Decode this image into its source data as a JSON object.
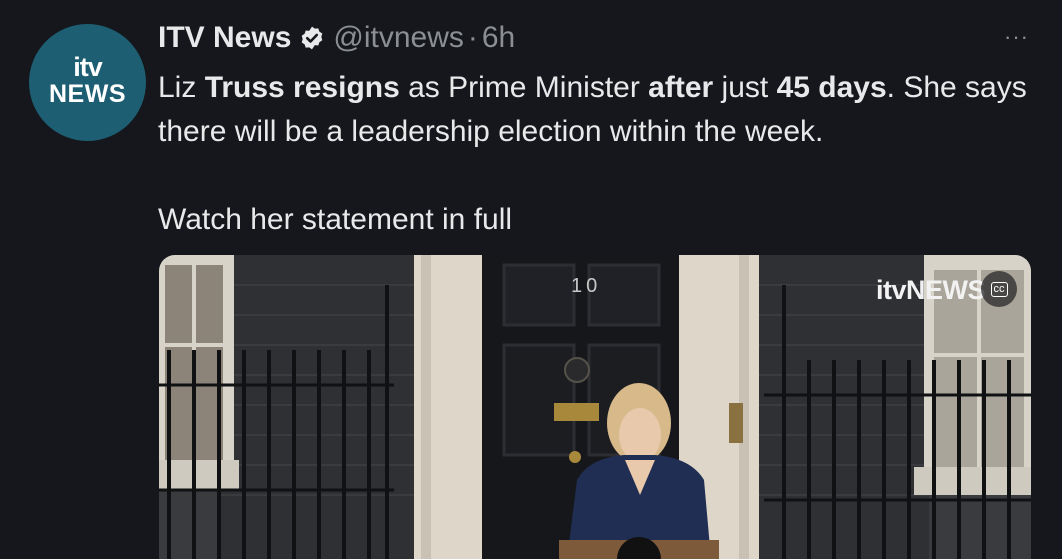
{
  "tweet": {
    "avatar": {
      "line1": "itv",
      "line2": "NEWS"
    },
    "display_name": "ITV News",
    "verified_icon": "verified-badge-icon",
    "handle": "@itvnews",
    "separator": "·",
    "time": "6h",
    "more_label": "···",
    "text": {
      "s1": "Liz ",
      "s2": "Truss resigns",
      "s3": " as Prime Minister ",
      "s4": "after",
      "s5": " just ",
      "s6": "45 days",
      "s7": ". She says there will be a leadership election within the week.",
      "s8": "Watch her statement in full"
    },
    "media": {
      "watermark": "itvNEWS",
      "cc_label": "cc",
      "door_number": "10"
    }
  },
  "colors": {
    "background": "#15171c",
    "text": "#e7e9ea",
    "secondary": "#8b8f94",
    "avatar": "#1d5e73"
  }
}
